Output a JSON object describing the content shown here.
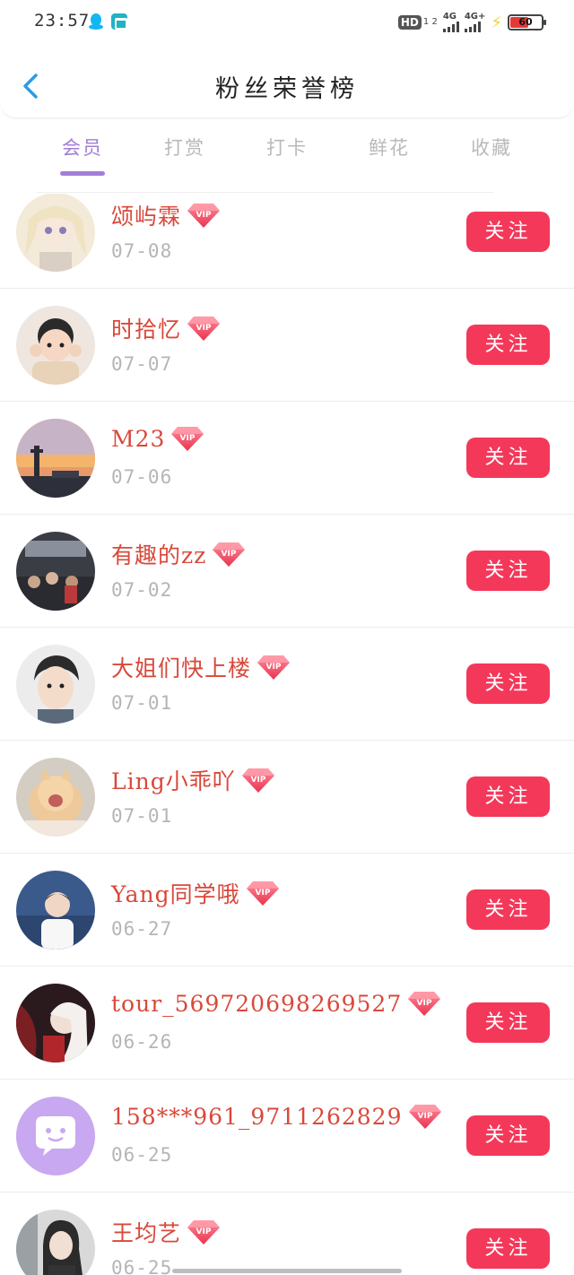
{
  "status_bar": {
    "time": "23:57",
    "hd": "HD",
    "hd_sub": "1 2",
    "net1": "4G",
    "net2": "4G+",
    "battery": "60",
    "battery_level": 0.6
  },
  "header": {
    "title": "粉丝荣誉榜",
    "back_icon": "chevron-left-icon"
  },
  "tabs": [
    {
      "label": "会员",
      "active": true
    },
    {
      "label": "打赏",
      "active": false
    },
    {
      "label": "打卡",
      "active": false
    },
    {
      "label": "鲜花",
      "active": false
    },
    {
      "label": "收藏",
      "active": false
    }
  ],
  "follow_label": "关注",
  "members": [
    {
      "name": "颂屿霖",
      "date": "07-08"
    },
    {
      "name": "时拾忆",
      "date": "07-07"
    },
    {
      "name": "M23",
      "date": "07-06"
    },
    {
      "name": "有趣的zz",
      "date": "07-02"
    },
    {
      "name": "大姐们快上楼",
      "date": "07-01"
    },
    {
      "name": "Ling小乖吖",
      "date": "07-01"
    },
    {
      "name": "Yang同学哦",
      "date": "06-27"
    },
    {
      "name": "tour_569720698269527",
      "date": "06-26"
    },
    {
      "name": "158***961_9711262829",
      "date": "06-25"
    },
    {
      "name": "王均艺",
      "date": "06-25"
    }
  ],
  "colors": {
    "accent": "#a27ed8",
    "follow_button": "#f4385a",
    "name_text": "#d9483b",
    "date_text": "#b5b5b5"
  }
}
